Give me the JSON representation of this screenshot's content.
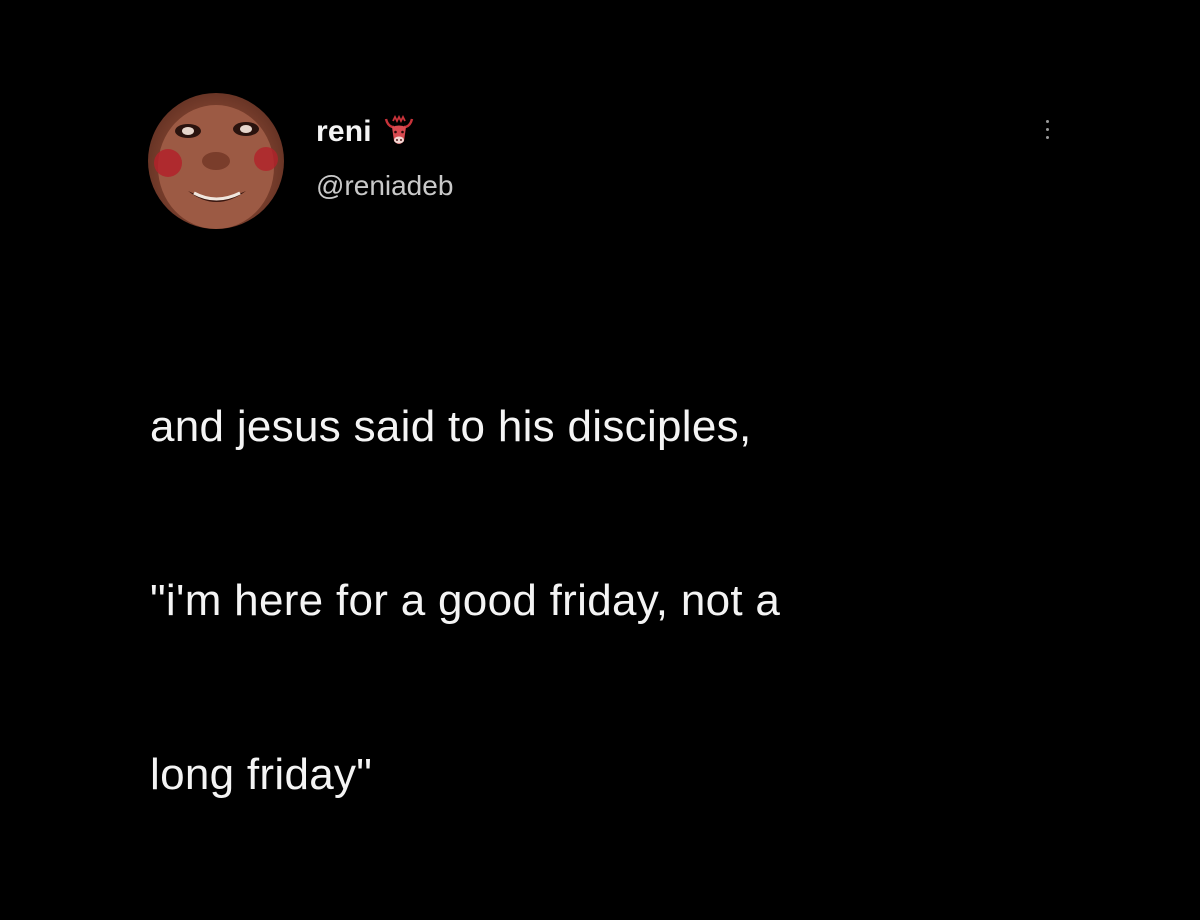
{
  "tweet": {
    "author": {
      "display_name": "reni",
      "handle": "@reniadeb",
      "avatar_icon": "avatar-photo",
      "badge_icon": "bull-emoji-icon"
    },
    "text_lines": [
      "and jesus said to his disciples,",
      "\"i'm here for a good friday, not a",
      "long friday\""
    ],
    "menu_icon": "more-options-icon"
  },
  "colors": {
    "background": "#000000",
    "text": "#f4f4f4",
    "handle": "#c9c9c9",
    "badge": "#c8333a"
  }
}
